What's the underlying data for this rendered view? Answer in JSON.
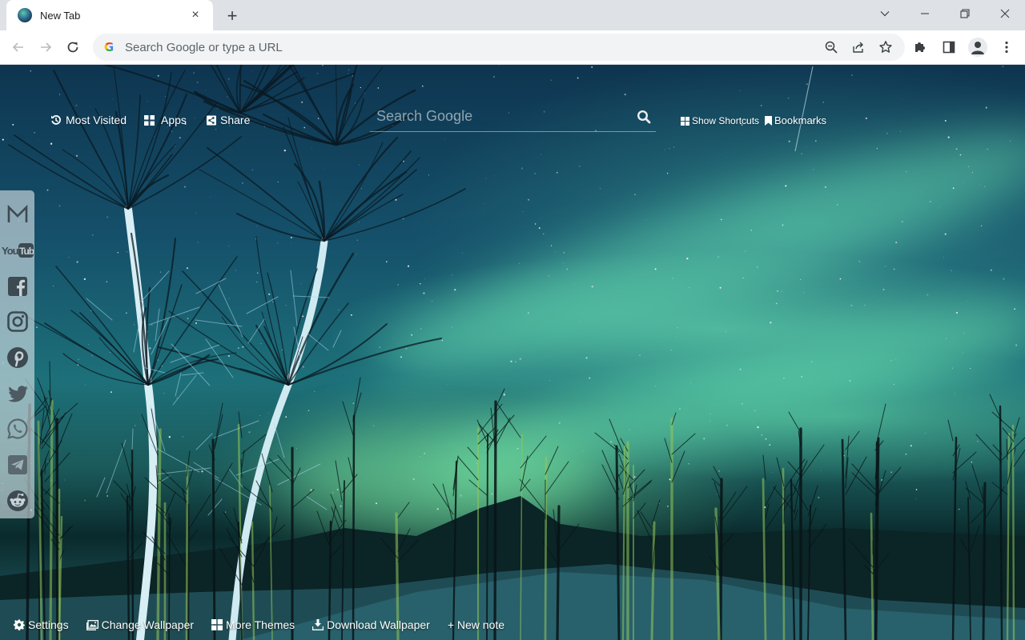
{
  "browser": {
    "tab": {
      "title": "New Tab",
      "close_label": "×"
    },
    "new_tab_label": "+",
    "omnibox": {
      "placeholder": "Search Google or type a URL",
      "value": ""
    },
    "window_controls": [
      "tab-search",
      "minimize",
      "restore",
      "close"
    ],
    "toolbar_icons": [
      "zoom-out-icon",
      "share-icon",
      "bookmark-star-icon",
      "extensions-icon",
      "side-panel-icon",
      "profile-icon",
      "menu-icon"
    ]
  },
  "newtab": {
    "top_links": [
      {
        "label": "Most Visited",
        "icon": "history-icon"
      },
      {
        "label": "Apps",
        "icon": "apps-grid-icon"
      },
      {
        "label": "Share",
        "icon": "share-icon"
      }
    ],
    "search": {
      "placeholder": "Search Google",
      "value": ""
    },
    "right_links": [
      {
        "label": "Show Shortcuts",
        "icon": "windows-grid-icon"
      },
      {
        "label": "Bookmarks",
        "icon": "bookmark-icon"
      }
    ],
    "social": [
      "Gmail",
      "YouTube",
      "Facebook",
      "Instagram",
      "Pinterest",
      "Twitter",
      "WhatsApp",
      "Telegram",
      "Reddit"
    ],
    "bottom_links": [
      {
        "label": "Settings",
        "icon": "gear-icon"
      },
      {
        "label": "Change Wallpaper",
        "icon": "image-icon"
      },
      {
        "label": "More Themes",
        "icon": "windows-grid-icon"
      },
      {
        "label": "Download Wallpaper",
        "icon": "download-icon"
      },
      {
        "label": "+ New note",
        "icon": ""
      }
    ],
    "wallpaper": {
      "subject": "Northern lights over birch forest",
      "accent": "#6ee6b4"
    }
  }
}
